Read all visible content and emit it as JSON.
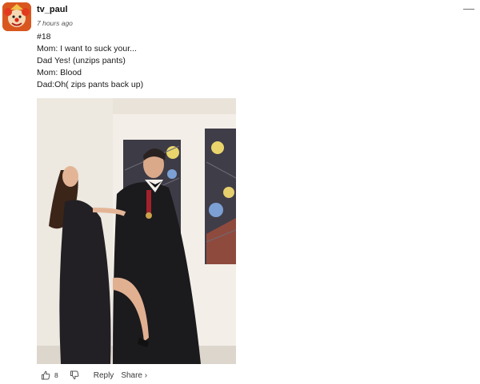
{
  "comment": {
    "username": "tv_paul",
    "time": "7 hours ago",
    "lines": [
      "#18",
      "Mom: I want to suck your...",
      "Dad Yes! (unzips pants)",
      "Mom: Blood",
      "Dad:Oh( zips pants back up)"
    ],
    "upvote_count": "8",
    "reply_label": "Reply",
    "share_label": "Share ›",
    "more_glyph": "—"
  },
  "icons": {
    "upvote": "thumbs-up-icon",
    "downvote": "thumbs-down-icon",
    "more": "minus-icon"
  }
}
